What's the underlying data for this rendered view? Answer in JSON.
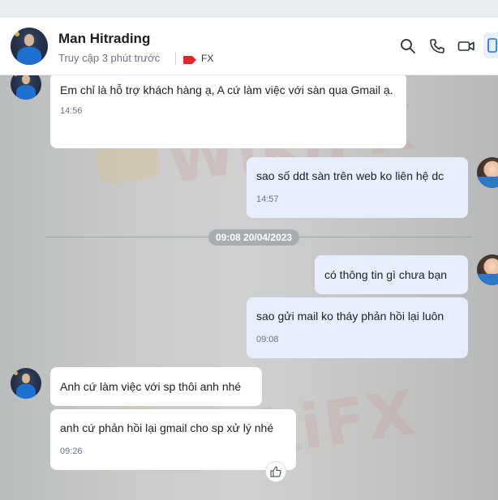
{
  "header": {
    "contact_name": "Man Hitrading",
    "last_seen": "Truy cập 3 phút trước",
    "tag_label": "FX",
    "tag_color": "#e5252a",
    "icons": [
      "search-icon",
      "phone-icon",
      "video-call-icon",
      "panel-toggle-icon"
    ]
  },
  "chat": {
    "date_separator": "09:08 20/04/2023",
    "watermark": "WikiFX",
    "messages": [
      {
        "side": "incoming",
        "text": "Em chỉ là hỗ trợ khách hàng ạ,  A cứ làm việc với sàn qua Gmail ạ.",
        "time": "14:56"
      },
      {
        "side": "outgoing",
        "text": "sao số ddt sàn trên web ko liên hệ dc",
        "time": "14:57"
      },
      {
        "side": "outgoing",
        "text": "có thông tin gì chưa bạn",
        "time": ""
      },
      {
        "side": "outgoing",
        "text": "sao gửi mail ko tháy phản hồi lại luôn",
        "time": "09:08"
      },
      {
        "side": "incoming",
        "text": "Anh cứ làm việc với sp thôi anh nhé",
        "time": ""
      },
      {
        "side": "incoming",
        "text": "anh cứ phản hồi lại gmail cho sp xử lý nhé",
        "time": "09:26"
      }
    ],
    "reaction_icon": "thumbs-up-icon"
  },
  "colors": {
    "incoming_bubble": "#ffffff",
    "outgoing_bubble": "#e7efff",
    "header_bg": "#ffffff"
  }
}
